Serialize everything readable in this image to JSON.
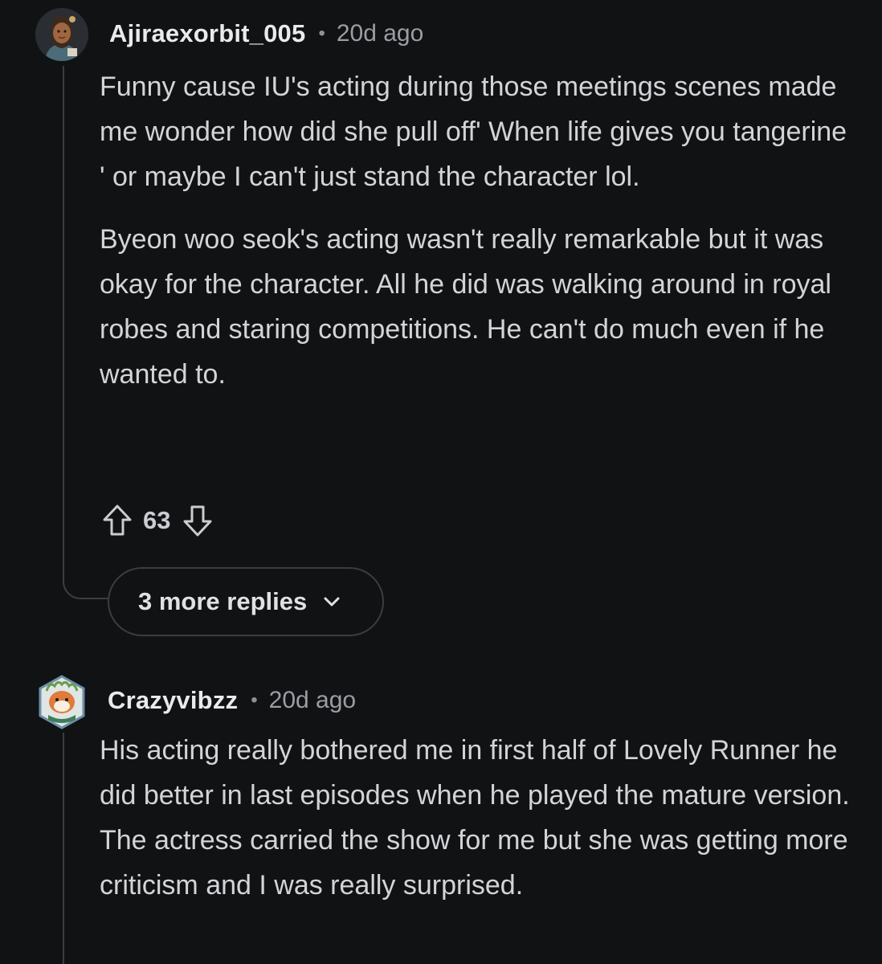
{
  "comments": [
    {
      "username": "Ajiraexorbit_005",
      "separator": "•",
      "time": "20d ago",
      "paragraphs": [
        "Funny cause IU's acting during those meetings scenes made me wonder how did she pull off' When life gives you tangerine ' or maybe I can't just stand the character lol.",
        "Byeon woo seok's acting wasn't really remarkable but it was okay for the character. All he did was walking around in royal robes and staring competitions. He can't do much even if he wanted to."
      ],
      "score": "63",
      "more_replies_label": "3 more replies"
    },
    {
      "username": "Crazyvibzz",
      "separator": "•",
      "time": "20d ago",
      "paragraphs": [
        "His acting really bothered me in first half of Lovely Runner he did better in last episodes when he played the mature version. The actress carried the show for me but she was getting more criticism and I was really surprised."
      ]
    }
  ],
  "icons": {
    "upvote": "arrow-up-icon",
    "downvote": "arrow-down-icon",
    "expand": "chevron-down-icon"
  },
  "colors": {
    "background": "#111214",
    "thread_line": "#3a3d42",
    "text": "#d2d5d8",
    "meta": "#9a9ea4"
  }
}
